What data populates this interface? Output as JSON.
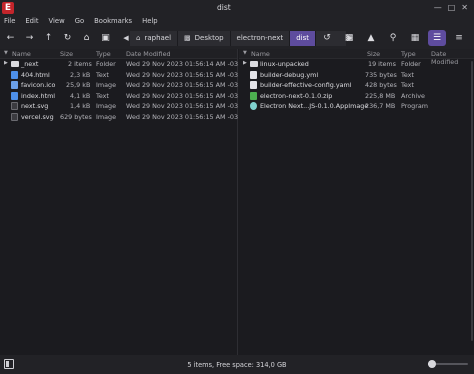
{
  "window": {
    "title": "dist",
    "min_glyph": "—",
    "max_glyph": "□",
    "close_glyph": "✕"
  },
  "menu": [
    "File",
    "Edit",
    "View",
    "Go",
    "Bookmarks",
    "Help"
  ],
  "breadcrumbs": [
    {
      "label": "raphael",
      "icon": "home-icon"
    },
    {
      "label": "Desktop",
      "icon": "desktop-folder-icon"
    },
    {
      "label": "electron-next",
      "icon": ""
    },
    {
      "label": "dist",
      "icon": ""
    }
  ],
  "columns": {
    "name": "Name",
    "size": "Size",
    "type": "Type",
    "date": "Date Modified"
  },
  "left_pane": {
    "rows": [
      {
        "name": "_next",
        "size": "2 items",
        "type": "Folder",
        "date": "Wed 29 Nov 2023 01:56:14 AM -03",
        "kind": "folder",
        "expandable": true
      },
      {
        "name": "404.html",
        "size": "2,3 kB",
        "type": "Text",
        "date": "Wed 29 Nov 2023 01:56:15 AM -03",
        "kind": "html",
        "expandable": false
      },
      {
        "name": "favicon.ico",
        "size": "25,9 kB",
        "type": "Image",
        "date": "Wed 29 Nov 2023 01:56:15 AM -03",
        "kind": "ico",
        "expandable": false
      },
      {
        "name": "index.html",
        "size": "4,1 kB",
        "type": "Text",
        "date": "Wed 29 Nov 2023 01:56:15 AM -03",
        "kind": "html",
        "expandable": false
      },
      {
        "name": "next.svg",
        "size": "1,4 kB",
        "type": "Image",
        "date": "Wed 29 Nov 2023 01:56:15 AM -03",
        "kind": "svg",
        "expandable": false
      },
      {
        "name": "vercel.svg",
        "size": "629 bytes",
        "type": "Image",
        "date": "Wed 29 Nov 2023 01:56:15 AM -03",
        "kind": "svg",
        "expandable": false
      }
    ]
  },
  "right_pane": {
    "rows": [
      {
        "name": "linux-unpacked",
        "size": "19 items",
        "type": "Folder",
        "kind": "folder",
        "expandable": true
      },
      {
        "name": "builder-debug.yml",
        "size": "735 bytes",
        "type": "Text",
        "kind": "file",
        "expandable": false
      },
      {
        "name": "builder-effective-config.yaml",
        "size": "428 bytes",
        "type": "Text",
        "kind": "file",
        "expandable": false
      },
      {
        "name": "electron-next-0.1.0.zip",
        "size": "225,8 MB",
        "type": "Archive",
        "kind": "zip",
        "expandable": false
      },
      {
        "name": "Electron Next...JS-0.1.0.AppImage",
        "size": "236,7 MB",
        "type": "Program",
        "kind": "app",
        "expandable": false
      }
    ]
  },
  "status": {
    "text": "5 items, Free space: 314,0 GB"
  },
  "zoom_level": 0.1
}
